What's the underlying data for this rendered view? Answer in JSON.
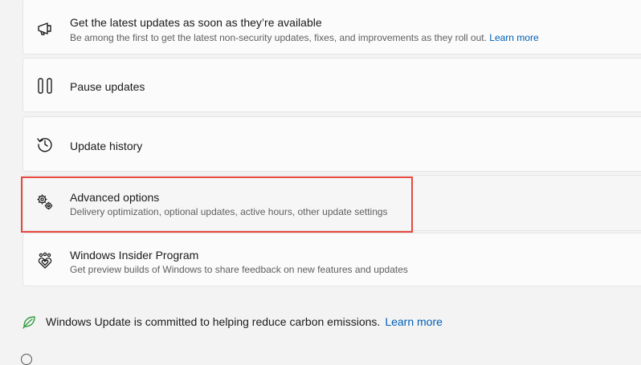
{
  "items": [
    {
      "title": "Get the latest updates as soon as they’re available",
      "description": "Be among the first to get the latest non-security updates, fixes, and improvements as they roll out.",
      "link": "Learn more",
      "icon": "megaphone-icon"
    },
    {
      "title": "Pause updates",
      "icon": "pause-icon"
    },
    {
      "title": "Update history",
      "icon": "history-icon"
    },
    {
      "title": "Advanced options",
      "description": "Delivery optimization, optional updates, active hours, other update settings",
      "icon": "gears-icon"
    },
    {
      "title": "Windows Insider Program",
      "description": "Get preview builds of Windows to share feedback on new features and updates",
      "icon": "insider-hearts-icon"
    }
  ],
  "footer": {
    "text": "Windows Update is committed to helping reduce carbon emissions.",
    "link": "Learn more",
    "icon": "leaf-icon"
  },
  "colors": {
    "accent": "#005fb8",
    "highlight_box": "#e8483f",
    "leaf": "#2e9b3c"
  }
}
